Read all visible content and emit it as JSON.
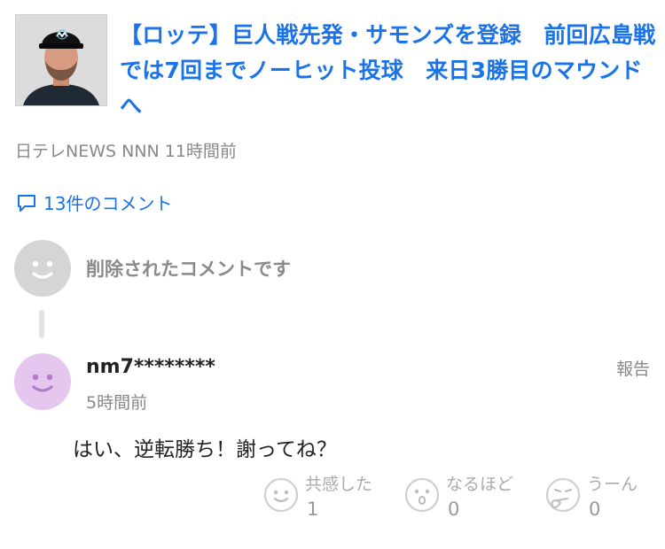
{
  "article": {
    "headline": "【ロッテ】巨人戦先発・サモンズを登録　前回広島戦では7回までノーヒット投球　来日3勝目のマウンドへ",
    "source": "日テレNEWS NNN",
    "time": "11時間前"
  },
  "comments_link": {
    "label": "13件のコメント"
  },
  "deleted_comment": {
    "text": "削除されたコメントです"
  },
  "reply": {
    "username": "nm7********",
    "time": "5時間前",
    "report_label": "報告",
    "body": "はい、逆転勝ち！謝ってね？",
    "reactions": [
      {
        "icon": "smile-face-icon",
        "label": "共感した",
        "count": "1"
      },
      {
        "icon": "surprised-face-icon",
        "label": "なるほど",
        "count": "0"
      },
      {
        "icon": "thinking-face-icon",
        "label": "うーん",
        "count": "0"
      }
    ]
  },
  "colors": {
    "link_blue": "#1a73e8",
    "gray_text": "#888888",
    "avatar_gray": "#d5d5d5",
    "avatar_purple": "#e4c6ee",
    "reaction_gray": "#b5b5b5"
  }
}
